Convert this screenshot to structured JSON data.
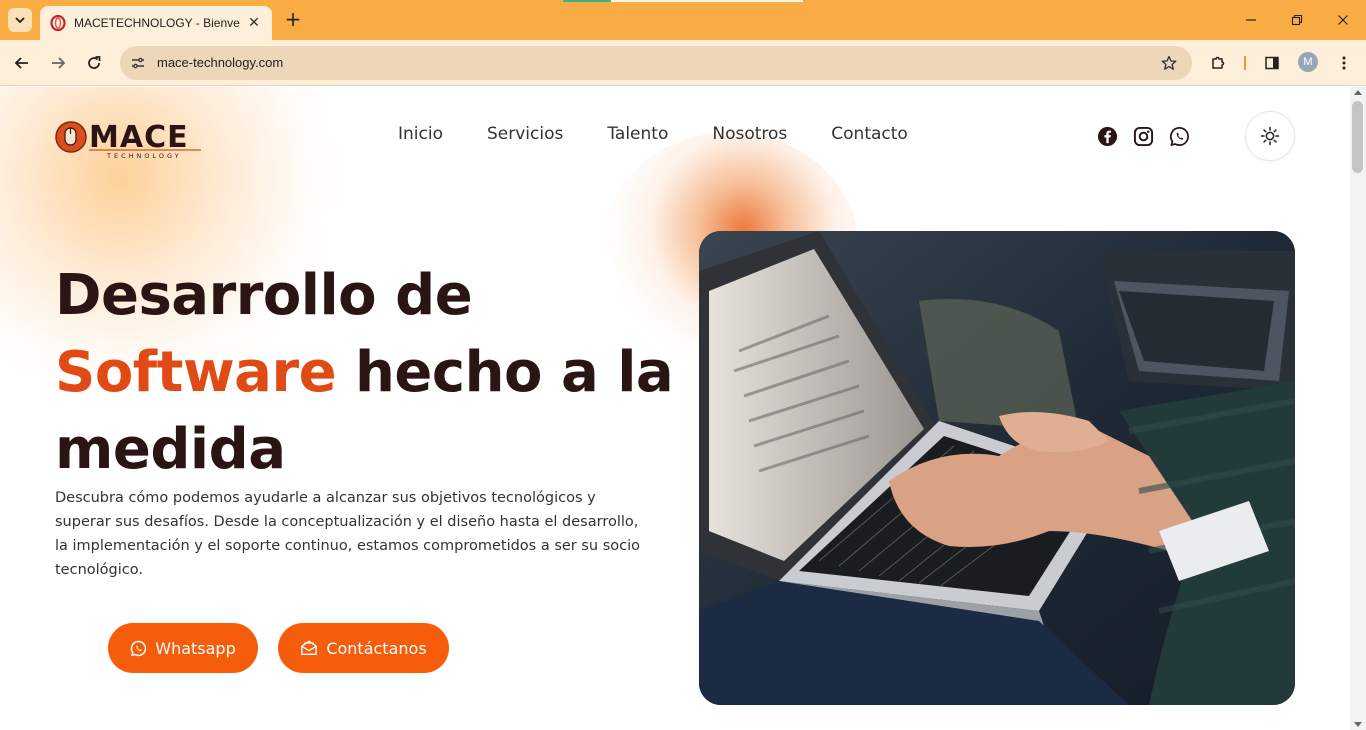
{
  "browser": {
    "tab_title": "MACETECHNOLOGY - Bienvenido",
    "tab_close": "✕",
    "new_tab": "+",
    "url": "mace-technology.com",
    "profile_initial": "M",
    "icons": {
      "tab_search": "chevron-down-icon",
      "favicon": "opera-o-icon",
      "back": "arrow-left-icon",
      "forward": "arrow-right-icon",
      "reload": "reload-icon",
      "site_info": "tune-icon",
      "bookmark": "star-icon",
      "extensions": "puzzle-icon",
      "side_panel": "side-panel-icon",
      "menu": "kebab-menu-icon",
      "minimize": "minimize-icon",
      "restore": "restore-icon",
      "close": "close-icon"
    },
    "colors": {
      "tabstrip": "#f9ac44",
      "toolbar": "#fdefd9",
      "omnibox": "#ecd8b8"
    }
  },
  "site": {
    "logo": {
      "text": "MACE",
      "subtext": "TECHNOLOGY"
    },
    "nav": [
      "Inicio",
      "Servicios",
      "Talento",
      "Nosotros",
      "Contacto"
    ],
    "social": [
      "facebook-icon",
      "instagram-icon",
      "whatsapp-icon"
    ],
    "theme_toggle": "sun-icon",
    "hero": {
      "title_line1": "Desarrollo de",
      "title_accent": "Software",
      "title_rest": " hecho a la",
      "title_line3": "medida",
      "description": "Descubra cómo podemos ayudarle a alcanzar sus objetivos tecnológicos y superar sus desafíos. Desde la conceptualización y el diseño hasta el desarrollo, la implementación y el soporte continuo, estamos comprometidos a ser su socio tecnológico.",
      "buttons": {
        "whatsapp": "Whatsapp",
        "contact": "Contáctanos"
      },
      "image": "laptop-typing-photo"
    },
    "colors": {
      "accent": "#e04a15",
      "button": "#f55c0c",
      "heading": "#2a1414"
    }
  }
}
